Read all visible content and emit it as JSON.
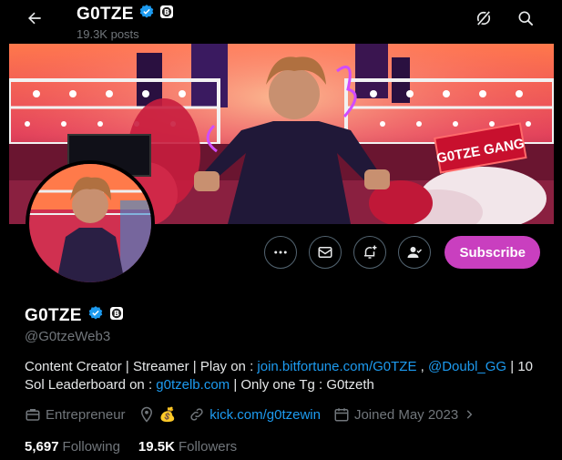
{
  "header": {
    "name": "G0TZE",
    "posts": "19.3K posts"
  },
  "profile": {
    "name": "G0TZE",
    "handle": "@G0tzeWeb3",
    "bio_1": "Content Creator | Streamer | Play on : ",
    "bio_link_1": "join.bitfortune.com/G0TZE",
    "bio_2": " , ",
    "bio_link_2": "@Doubl_GG",
    "bio_3": " | 10 Sol Leaderboard on : ",
    "bio_link_3": "g0tzelb.com",
    "bio_4": " | Only one Tg : G0tzeth",
    "category": "Entrepreneur",
    "location_emoji": "💰",
    "website": "kick.com/g0tzewin",
    "joined": "Joined May 2023",
    "following_count": "5,697",
    "following_label": "Following",
    "followers_count": "19.5K",
    "followers_label": "Followers"
  },
  "actions": {
    "subscribe_label": "Subscribe"
  },
  "banner": {
    "sign_text": "G0TZE GANG"
  },
  "colors": {
    "accent_blue": "#1d9bf0",
    "subscribe": "#c93fbf",
    "muted": "#71767b"
  }
}
